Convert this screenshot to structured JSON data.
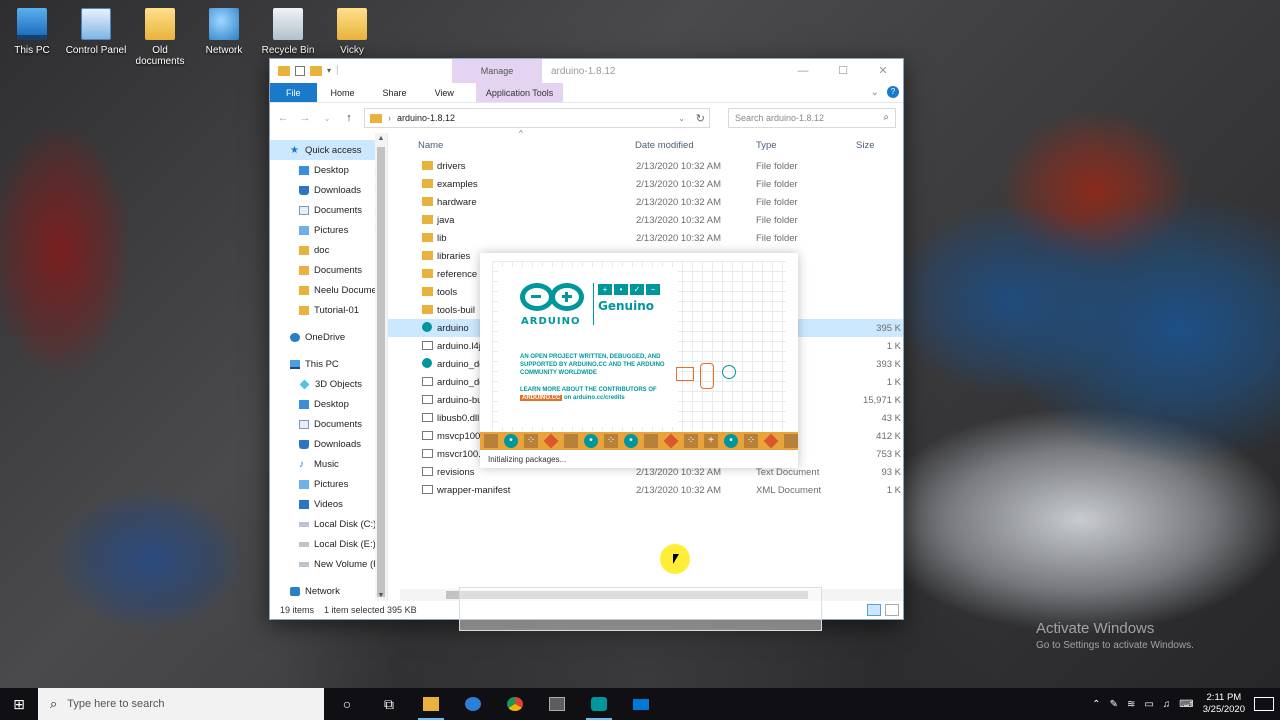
{
  "desktop": {
    "icons": [
      {
        "label": "This PC",
        "icon": "this-pc-icon"
      },
      {
        "label": "Control Panel",
        "icon": "control-panel-icon"
      },
      {
        "label": "Old documents",
        "icon": "folder-icon"
      },
      {
        "label": "Network",
        "icon": "network-icon"
      },
      {
        "label": "Recycle Bin",
        "icon": "recycle-bin-icon"
      },
      {
        "label": "Vicky",
        "icon": "user-folder-icon"
      }
    ]
  },
  "explorer": {
    "title": "arduino-1.8.12",
    "manage_tab": "Manage",
    "ribbon_tabs": [
      "File",
      "Home",
      "Share",
      "View",
      "Application Tools"
    ],
    "address_path": "arduino-1.8.12",
    "search_placeholder": "Search arduino-1.8.12",
    "columns": {
      "name": "Name",
      "date": "Date modified",
      "type": "Type",
      "size": "Size"
    },
    "nav": {
      "quick_access": "Quick access",
      "quick_items": [
        {
          "label": "Desktop",
          "pinned": true
        },
        {
          "label": "Downloads",
          "pinned": true
        },
        {
          "label": "Documents",
          "pinned": true
        },
        {
          "label": "Pictures",
          "pinned": true
        },
        {
          "label": "doc"
        },
        {
          "label": "Documents"
        },
        {
          "label": "Neelu Documen"
        },
        {
          "label": "Tutorial-01"
        }
      ],
      "onedrive": "OneDrive",
      "this_pc": "This PC",
      "pc_items": [
        "3D Objects",
        "Desktop",
        "Documents",
        "Downloads",
        "Music",
        "Pictures",
        "Videos",
        "Local Disk (C:)",
        "Local Disk (E:)",
        "New Volume (F:)"
      ],
      "network": "Network"
    },
    "files": [
      {
        "name": "drivers",
        "date": "2/13/2020 10:32 AM",
        "type": "File folder",
        "size": "",
        "kind": "folder"
      },
      {
        "name": "examples",
        "date": "2/13/2020 10:32 AM",
        "type": "File folder",
        "size": "",
        "kind": "folder"
      },
      {
        "name": "hardware",
        "date": "2/13/2020 10:32 AM",
        "type": "File folder",
        "size": "",
        "kind": "folder"
      },
      {
        "name": "java",
        "date": "2/13/2020 10:32 AM",
        "type": "File folder",
        "size": "",
        "kind": "folder"
      },
      {
        "name": "lib",
        "date": "2/13/2020 10:32 AM",
        "type": "File folder",
        "size": "",
        "kind": "folder"
      },
      {
        "name": "libraries",
        "date": "",
        "type": "",
        "size": "",
        "kind": "folder"
      },
      {
        "name": "reference",
        "date": "",
        "type": "",
        "size": "",
        "kind": "folder"
      },
      {
        "name": "tools",
        "date": "",
        "type": "",
        "size": "",
        "kind": "folder"
      },
      {
        "name": "tools-buil",
        "date": "",
        "type": "",
        "size": "",
        "kind": "folder"
      },
      {
        "name": "arduino",
        "date": "",
        "type": "on",
        "size": "395 K",
        "kind": "app",
        "selected": true
      },
      {
        "name": "arduino.l4j",
        "date": "",
        "type": "ation setti",
        "size": "1 K",
        "kind": "file"
      },
      {
        "name": "arduino_de",
        "date": "",
        "type": "on",
        "size": "393 K",
        "kind": "app"
      },
      {
        "name": "arduino_de",
        "date": "",
        "type": "ation setti",
        "size": "1 K",
        "kind": "file"
      },
      {
        "name": "arduino-bu",
        "date": "",
        "type": "",
        "size": "15,971 K",
        "kind": "file"
      },
      {
        "name": "libusb0.dll",
        "date": "",
        "type": "n extens",
        "size": "43 K",
        "kind": "file"
      },
      {
        "name": "msvcp100.",
        "date": "",
        "type": "n extens",
        "size": "412 K",
        "kind": "file"
      },
      {
        "name": "msvcr100.c",
        "date": "",
        "type": "n extens",
        "size": "753 K",
        "kind": "file"
      },
      {
        "name": "revisions",
        "date": "2/13/2020 10:32 AM",
        "type": "Text Document",
        "size": "93 K",
        "kind": "file"
      },
      {
        "name": "wrapper-manifest",
        "date": "2/13/2020 10:32 AM",
        "type": "XML Document",
        "size": "1 K",
        "kind": "file"
      }
    ],
    "status": {
      "count": "19 items",
      "selection": "1 item selected  395 KB"
    }
  },
  "splash": {
    "brand": "ARDUINO",
    "brand2": "Genuino",
    "marks": [
      "+",
      "•",
      "✓",
      "−"
    ],
    "tagline": "AN OPEN PROJECT WRITTEN, DEBUGGED, AND SUPPORTED BY ARDUINO.CC AND THE ARDUINO COMMUNITY WORLDWIDE",
    "credits_pre": "LEARN MORE ABOUT THE CONTRIBUTORS OF",
    "credits_hl": "ARDUINO.CC",
    "credits_post": "on arduino.cc/credits",
    "status": "Initializing packages..."
  },
  "watermark": {
    "title": "Activate Windows",
    "subtitle": "Go to Settings to activate Windows."
  },
  "taskbar": {
    "search_placeholder": "Type here to search",
    "apps": [
      "cortana-icon",
      "task-view-icon",
      "file-explorer-icon",
      "edge-icon",
      "chrome-icon",
      "calculator-icon",
      "arduino-icon",
      "mail-icon"
    ],
    "time": "2:11 PM",
    "date": "3/25/2020"
  },
  "colors": {
    "file_tab": "#1979ca",
    "manage": "#e5d4f1",
    "arduino": "#00979c",
    "arduino_orange": "#e47128",
    "selection": "#cce8ff"
  }
}
